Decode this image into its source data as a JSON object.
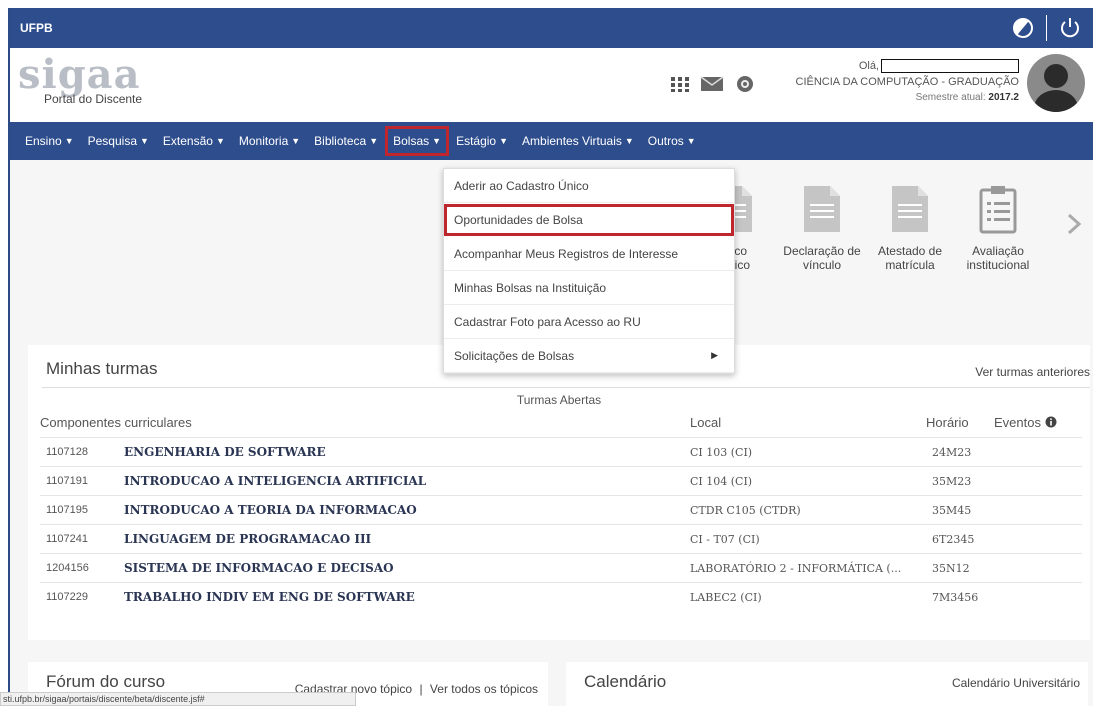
{
  "topbar": {
    "brand": "UFPB",
    "icons": [
      "contrast-icon",
      "power-icon"
    ]
  },
  "header": {
    "logo_text": "sigaa",
    "logo_sub": "Portal do Discente",
    "greeting": "Olá,",
    "course": "CIÊNCIA DA COMPUTAÇÃO - GRADUAÇÃO",
    "semester_label": "Semestre atual:",
    "semester_value": "2017.2",
    "icons": [
      "apps-grid-icon",
      "mail-icon",
      "network-icon"
    ]
  },
  "nav": {
    "items": [
      {
        "label": "Ensino"
      },
      {
        "label": "Pesquisa"
      },
      {
        "label": "Extensão"
      },
      {
        "label": "Monitoria"
      },
      {
        "label": "Biblioteca"
      },
      {
        "label": "Bolsas"
      },
      {
        "label": "Estágio"
      },
      {
        "label": "Ambientes Virtuais"
      },
      {
        "label": "Outros"
      }
    ],
    "active": "Bolsas"
  },
  "dropdown": {
    "items": [
      {
        "label": "Aderir ao Cadastro Único"
      },
      {
        "label": "Oportunidades de Bolsa"
      },
      {
        "label": "Acompanhar Meus Registros de Interesse"
      },
      {
        "label": "Minhas Bolsas na Instituição"
      },
      {
        "label": "Cadastrar Foto para Acesso ao RU"
      },
      {
        "label": "Solicitações de Bolsas"
      }
    ],
    "highlighted": "Oportunidades de Bolsa"
  },
  "shortcuts": [
    {
      "line1": "órico",
      "line2": "êmico"
    },
    {
      "line1": "Declaração de",
      "line2": "vínculo"
    },
    {
      "line1": "Atestado de",
      "line2": "matrícula"
    },
    {
      "line1": "Avaliação",
      "line2": "institucional"
    }
  ],
  "turmas": {
    "title": "Minhas turmas",
    "link": "Ver turmas anteriores",
    "subheading": "Turmas Abertas",
    "columns": {
      "componentes": "Componentes curriculares",
      "local": "Local",
      "horario": "Horário",
      "eventos": "Eventos"
    },
    "rows": [
      {
        "code": "1107128",
        "name": "ENGENHARIA DE SOFTWARE",
        "local": "CI 103 (CI)",
        "horario": "24M23"
      },
      {
        "code": "1107191",
        "name": "INTRODUCAO A INTELIGENCIA ARTIFICIAL",
        "local": "CI 104 (CI)",
        "horario": "35M23"
      },
      {
        "code": "1107195",
        "name": "INTRODUCAO A TEORIA DA INFORMACAO",
        "local": "CTDR C105 (CTDR)",
        "horario": "35M45"
      },
      {
        "code": "1107241",
        "name": "LINGUAGEM DE PROGRAMACAO III",
        "local": "CI - T07 (CI)",
        "horario": "6T2345"
      },
      {
        "code": "1204156",
        "name": "SISTEMA DE INFORMACAO E DECISAO",
        "local": "LABORATÓRIO 2 - INFORMÁTICA (...",
        "horario": "35N12"
      },
      {
        "code": "1107229",
        "name": "TRABALHO INDIV EM ENG DE SOFTWARE",
        "local": "LABEC2 (CI)",
        "horario": "7M3456"
      }
    ]
  },
  "forum": {
    "title": "Fórum do curso",
    "new_topic": "Cadastrar novo tópico",
    "separator": "|",
    "all_topics": "Ver todos os tópicos"
  },
  "calendar": {
    "title": "Calendário",
    "link": "Calendário Universitário"
  },
  "statusbar": {
    "url": "sti.ufpb.br/sigaa/portais/discente/beta/discente.jsf#"
  }
}
